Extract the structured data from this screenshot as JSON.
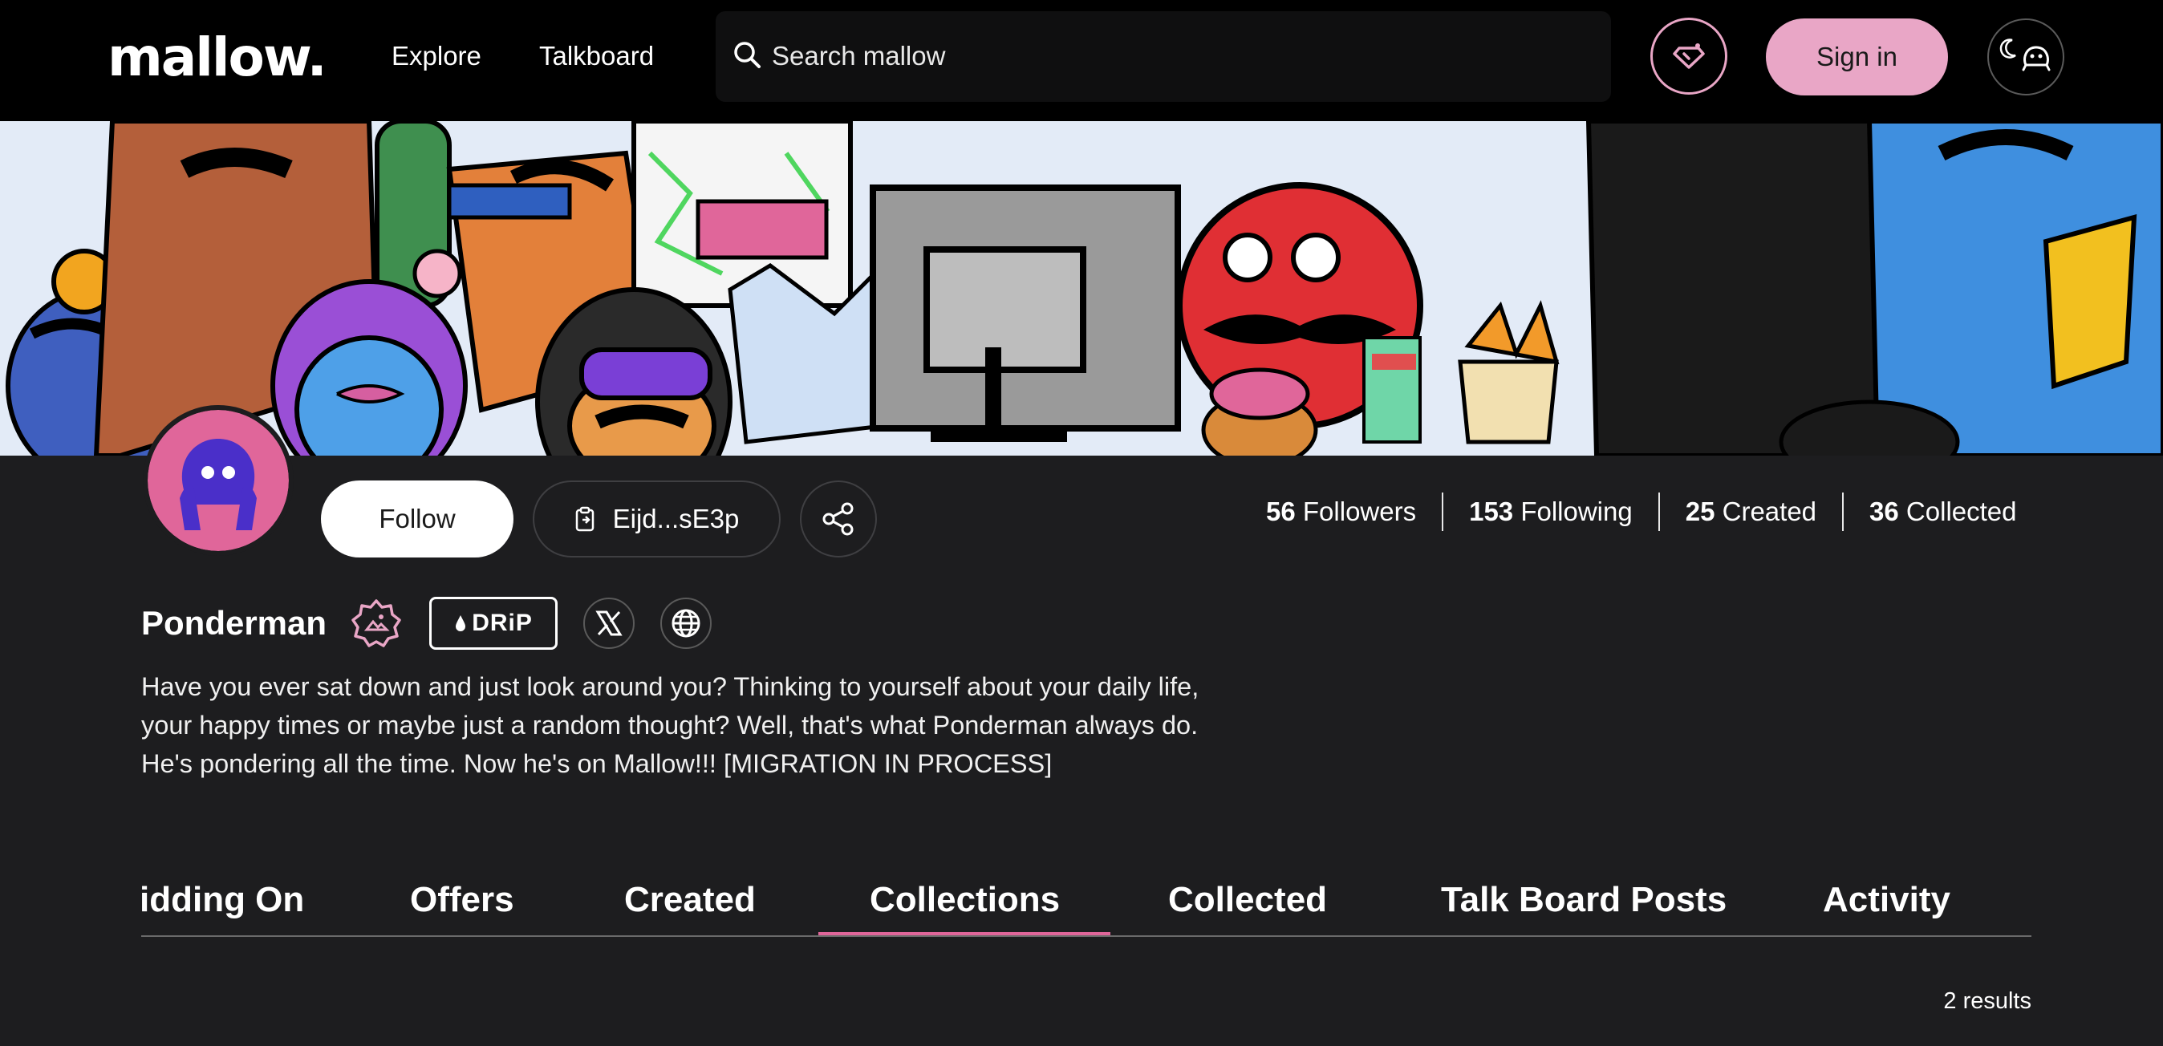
{
  "header": {
    "logo": "mallow.",
    "nav": {
      "explore": "Explore",
      "talkboard": "Talkboard"
    },
    "search": {
      "placeholder": "Search mallow",
      "value": ""
    },
    "sign_in": "Sign in"
  },
  "profile": {
    "follow": "Follow",
    "wallet": "Eijd...sE3p",
    "stats": {
      "followers_count": "56",
      "followers_label": "Followers",
      "following_count": "153",
      "following_label": "Following",
      "created_count": "25",
      "created_label": "Created",
      "collected_count": "36",
      "collected_label": "Collected"
    },
    "name": "Ponderman",
    "drip": "DRiP",
    "bio": "Have you ever sat down and just look around you? Thinking to yourself about your daily life, your happy times or maybe just a random thought? Well, that's what Ponderman always do. He's pondering all the time. Now he's on Mallow!!! [MIGRATION IN PROCESS]"
  },
  "tabs": {
    "bidding_on": "idding On",
    "offers": "Offers",
    "created": "Created",
    "collections": "Collections",
    "collected": "Collected",
    "talk_board_posts": "Talk Board Posts",
    "activity": "Activity",
    "active": "Collections"
  },
  "results": "2 results",
  "colors": {
    "accent_pink": "#e9a6c6",
    "underline_pink": "#e0669a",
    "background": "#1d1d1f",
    "topbar": "#000000"
  },
  "icons": [
    "search-icon",
    "diamond-icon",
    "moon-icon",
    "theme-face-icon",
    "clipboard-icon",
    "share-icon",
    "verified-badge-icon",
    "drop-icon",
    "x-logo-icon",
    "globe-icon"
  ]
}
